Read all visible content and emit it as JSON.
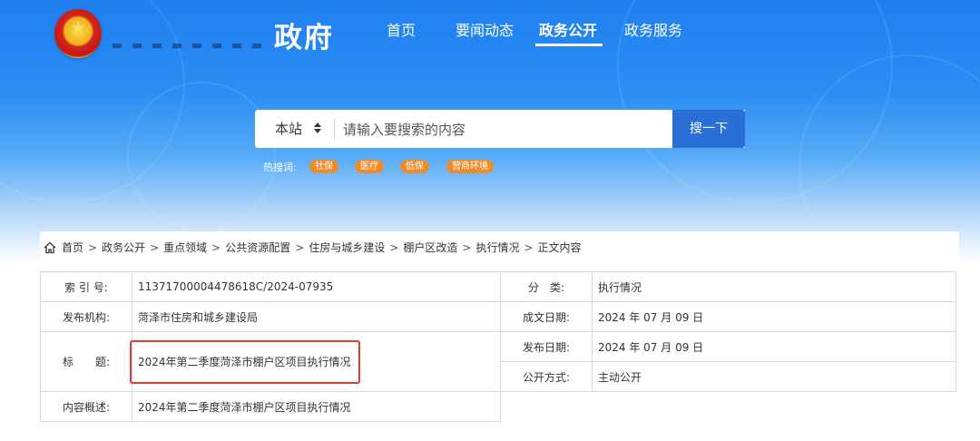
{
  "header": {
    "title": "政府",
    "emblem_icon": "national-emblem-icon"
  },
  "nav": {
    "items": [
      {
        "label": "首页"
      },
      {
        "label": "要闻动态"
      },
      {
        "label": "政务公开"
      },
      {
        "label": "政务服务"
      }
    ],
    "active_index": 2
  },
  "search": {
    "scope": "本站",
    "scope_icon": "sort-updown-icon",
    "placeholder": "请输入要搜索的内容",
    "button_label": "搜一下",
    "hot_label": "热搜词:",
    "hot_tags": [
      "社保",
      "医疗",
      "低保",
      "营商环境"
    ]
  },
  "breadcrumb": {
    "icon": "home-icon",
    "items": [
      "首页",
      "政务公开",
      "重点领域",
      "公共资源配置",
      "住房与城乡建设",
      "棚户区改造",
      "执行情况",
      "正文内容"
    ],
    "separator": ">"
  },
  "meta": {
    "index_label": "索 引 号:",
    "index_value": "11371700004478618C/2024-07935",
    "category_label": "分　类:",
    "category_value": "执行情况",
    "issuer_label": "发布机构:",
    "issuer_value": "菏泽市住房和城乡建设局",
    "created_label": "成文日期:",
    "created_value": "2024 年 07 月 09 日",
    "title_label": "标　　题:",
    "title_value": "2024年第二季度菏泽市棚户区项目执行情况",
    "published_label": "发布日期:",
    "published_value": "2024 年 07 月 09 日",
    "disclosure_label": "公开方式:",
    "disclosure_value": "主动公开",
    "summary_label": "内容概述:",
    "summary_value": "2024年第二季度菏泽市棚户区项目执行情况"
  },
  "colors": {
    "header_blue": "#1f7ff0",
    "search_button": "#2a6fd6",
    "hot_tag": "#ee8c2a",
    "highlight": "#e53935"
  }
}
